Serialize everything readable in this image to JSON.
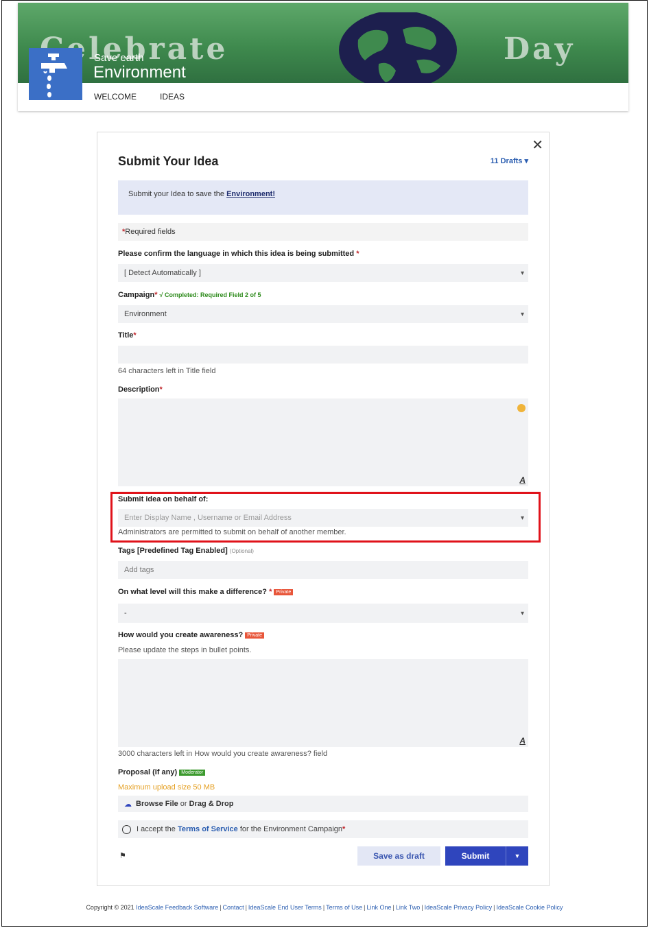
{
  "header": {
    "banner_word_1": "Celebrate",
    "banner_word_2": "Day",
    "site_subtitle": "Save earth",
    "site_title": "Environment",
    "nav": [
      "WELCOME",
      "IDEAS"
    ]
  },
  "modal": {
    "title": "Submit Your Idea",
    "drafts": "11 Drafts",
    "info_prefix": "Submit your Idea to save the ",
    "info_link": "Environment!",
    "required_fields": "Required fields",
    "language": {
      "label": "Please confirm the language in which this idea is being submitted",
      "value": "[ Detect Automatically ]"
    },
    "campaign": {
      "label": "Campaign",
      "completed": "√ Completed: Required Field 2 of 5",
      "value": "Environment"
    },
    "title_field": {
      "label": "Title",
      "help": "64 characters left in Title field"
    },
    "description": {
      "label": "Description"
    },
    "behalf": {
      "label": "Submit idea on behalf of:",
      "placeholder": "Enter Display Name , Username or Email Address",
      "help": "Administrators are permitted to submit on behalf of another member."
    },
    "tags": {
      "label": "Tags [Predefined Tag Enabled]",
      "optional": "(Optional)",
      "placeholder": "Add tags"
    },
    "level": {
      "label": "On what level will this make a difference?",
      "badge": "Private",
      "value": "-"
    },
    "awareness": {
      "label": "How would you create awareness?",
      "badge": "Private",
      "help_top": "Please update the steps in bullet points.",
      "help_bottom": "3000 characters left in How would you create awareness? field"
    },
    "proposal": {
      "label": "Proposal (If any)",
      "badge": "Moderator",
      "max_size": "Maximum upload size 50 MB",
      "browse": "Browse File",
      "or": " or ",
      "drag": "Drag & Drop"
    },
    "accept": {
      "prefix": "I accept the ",
      "link": "Terms of Service",
      "suffix": " for the Environment Campaign"
    },
    "save_draft": "Save as draft",
    "submit": "Submit"
  },
  "footer": {
    "copyright": "Copyright © 2021 ",
    "links": [
      "IdeaScale Feedback Software",
      "Contact",
      "IdeaScale End User Terms",
      "Terms of Use",
      "Link One",
      "Link Two",
      "IdeaScale Privacy Policy",
      "IdeaScale Cookie Policy"
    ]
  }
}
